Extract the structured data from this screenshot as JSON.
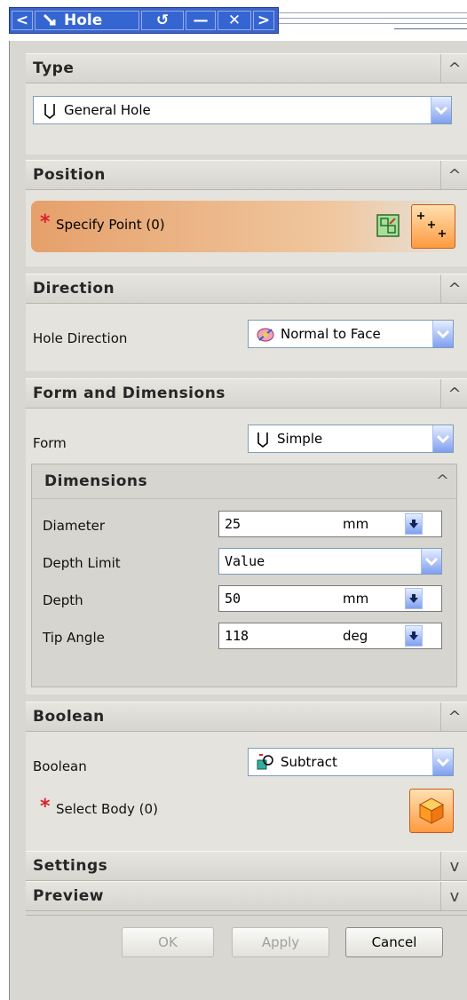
{
  "titlebar": {
    "title": "Hole",
    "back_symbol": "<",
    "forward_symbol": ">",
    "reset_symbol": "↺",
    "minimize_symbol": "—",
    "close_symbol": "✕"
  },
  "sections": {
    "type": {
      "title": "Type",
      "selected": "General Hole",
      "chevron": "^"
    },
    "position": {
      "title": "Position",
      "specify_point": "Specify Point (0)",
      "required_marker": "*",
      "chevron": "^"
    },
    "direction": {
      "title": "Direction",
      "label": "Hole Direction",
      "selected": "Normal to Face",
      "chevron": "^"
    },
    "form_dimensions": {
      "title": "Form and Dimensions",
      "form_label": "Form",
      "form_selected": "Simple",
      "chevron": "^",
      "dimensions": {
        "title": "Dimensions",
        "chevron": "^",
        "diameter": {
          "label": "Diameter",
          "value": "25",
          "unit": "mm"
        },
        "depth_limit": {
          "label": "Depth Limit",
          "value": "Value"
        },
        "depth": {
          "label": "Depth",
          "value": "50",
          "unit": "mm"
        },
        "tip_angle": {
          "label": "Tip Angle",
          "value": "118",
          "unit": "deg"
        }
      }
    },
    "boolean": {
      "title": "Boolean",
      "label": "Boolean",
      "selected": "Subtract",
      "select_body": "Select Body (0)",
      "required_marker": "*",
      "chevron": "^"
    },
    "settings": {
      "title": "Settings",
      "chevron": "v"
    },
    "preview": {
      "title": "Preview",
      "chevron": "v"
    }
  },
  "buttons": {
    "ok": "OK",
    "apply": "Apply",
    "cancel": "Cancel"
  },
  "colors": {
    "accent_blue": "#3565d0",
    "required_red": "#e0202a",
    "position_highlight": "#e6a06a"
  }
}
